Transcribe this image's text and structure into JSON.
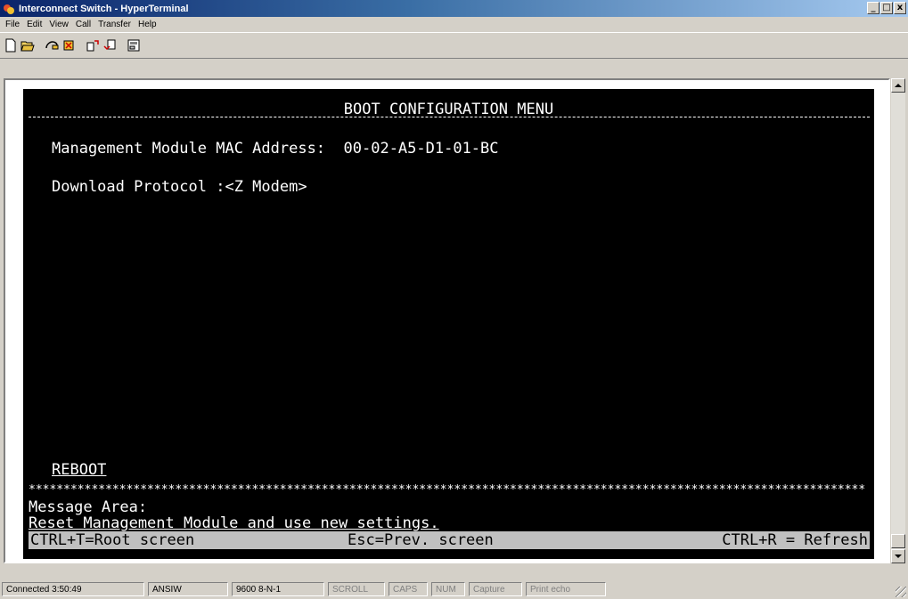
{
  "window": {
    "title": "Interconnect Switch - HyperTerminal",
    "buttons": [
      "_",
      "□",
      "x"
    ]
  },
  "menu": [
    "File",
    "Edit",
    "View",
    "Call",
    "Transfer",
    "Help"
  ],
  "toolbar": {
    "icons": [
      "new-icon",
      "open-icon",
      "connect-icon",
      "disconnect-icon",
      "send-icon",
      "receive-icon",
      "properties-icon"
    ]
  },
  "terminal": {
    "title": "BOOT CONFIGURATION MENU",
    "mac_line": "Management Module MAC Address:  00-02-A5-D1-01-BC",
    "download_line": "Download Protocol :<Z Modem>",
    "reboot": "REBOOT",
    "stars": "************************************************************************************************************************",
    "message_label": "Message Area:",
    "message_text": "Reset Management Module and use new settings.",
    "status": {
      "left": "CTRL+T=Root screen",
      "middle": "Esc=Prev. screen",
      "right": "CTRL+R = Refresh"
    }
  },
  "statusbar": {
    "connected": "Connected 3:50:49",
    "emulation": "ANSIW",
    "settings": "9600 8-N-1",
    "scroll": "SCROLL",
    "caps": "CAPS",
    "num": "NUM",
    "capture": "Capture",
    "print_echo": "Print echo"
  }
}
